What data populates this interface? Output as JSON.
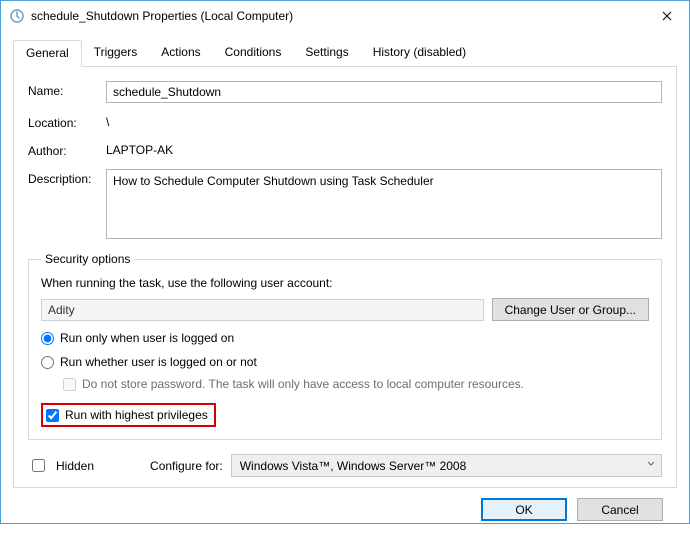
{
  "window": {
    "title": "schedule_Shutdown Properties (Local Computer)"
  },
  "tabs": {
    "general": "General",
    "triggers": "Triggers",
    "actions": "Actions",
    "conditions": "Conditions",
    "settings": "Settings",
    "history": "History (disabled)"
  },
  "labels": {
    "name": "Name:",
    "location": "Location:",
    "author": "Author:",
    "description": "Description:",
    "security_legend": "Security options",
    "account_prompt": "When running the task, use the following user account:",
    "change_user": "Change User or Group...",
    "run_logged_on": "Run only when user is logged on",
    "run_whether": "Run whether user is logged on or not",
    "no_store_pw": "Do not store password.  The task will only have access to local computer resources.",
    "highest_priv": "Run with highest privileges",
    "hidden": "Hidden",
    "configure_for": "Configure for:",
    "ok": "OK",
    "cancel": "Cancel"
  },
  "values": {
    "name": "schedule_Shutdown",
    "location": "\\",
    "author": "LAPTOP-AK",
    "description": "How to Schedule Computer Shutdown using Task Scheduler",
    "user_account": "Adity",
    "configure_for": "Windows Vista™, Windows Server™ 2008"
  },
  "state": {
    "run_logged_on_selected": true,
    "run_whether_selected": false,
    "no_store_pw_checked": false,
    "highest_priv_checked": true,
    "hidden_checked": false
  }
}
